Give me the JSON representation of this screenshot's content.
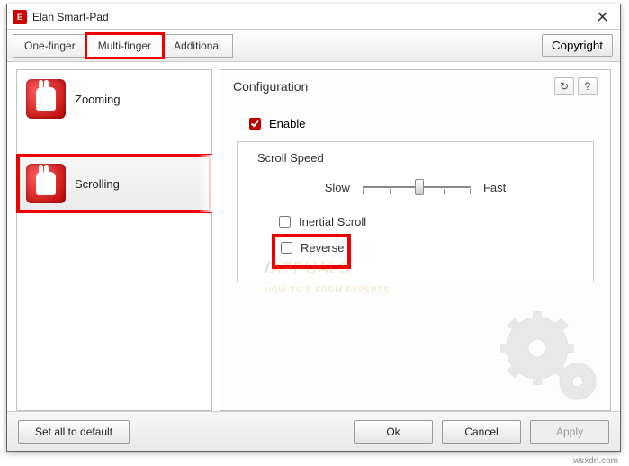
{
  "window": {
    "title": "Elan Smart-Pad"
  },
  "tabs": [
    {
      "label": "One-finger"
    },
    {
      "label": "Multi-finger"
    },
    {
      "label": "Additional"
    }
  ],
  "copyright_label": "Copyright",
  "sidebar": {
    "items": [
      {
        "label": "Zooming"
      },
      {
        "label": "Scrolling"
      }
    ]
  },
  "config": {
    "header": "Configuration",
    "refresh_tip": "↻",
    "help_tip": "?",
    "enable_label": "Enable",
    "group_title": "Scroll Speed",
    "slow_label": "Slow",
    "fast_label": "Fast",
    "inertial_label": "Inertial Scroll",
    "reverse_label": "Reverse"
  },
  "footer": {
    "default_label": "Set all to default",
    "ok": "Ok",
    "cancel": "Cancel",
    "apply": "Apply"
  },
  "watermark": {
    "brand": "APPUALS",
    "tag": "HOW-TO'S FROM EXPERTS"
  },
  "credit": "wsxdn.com"
}
